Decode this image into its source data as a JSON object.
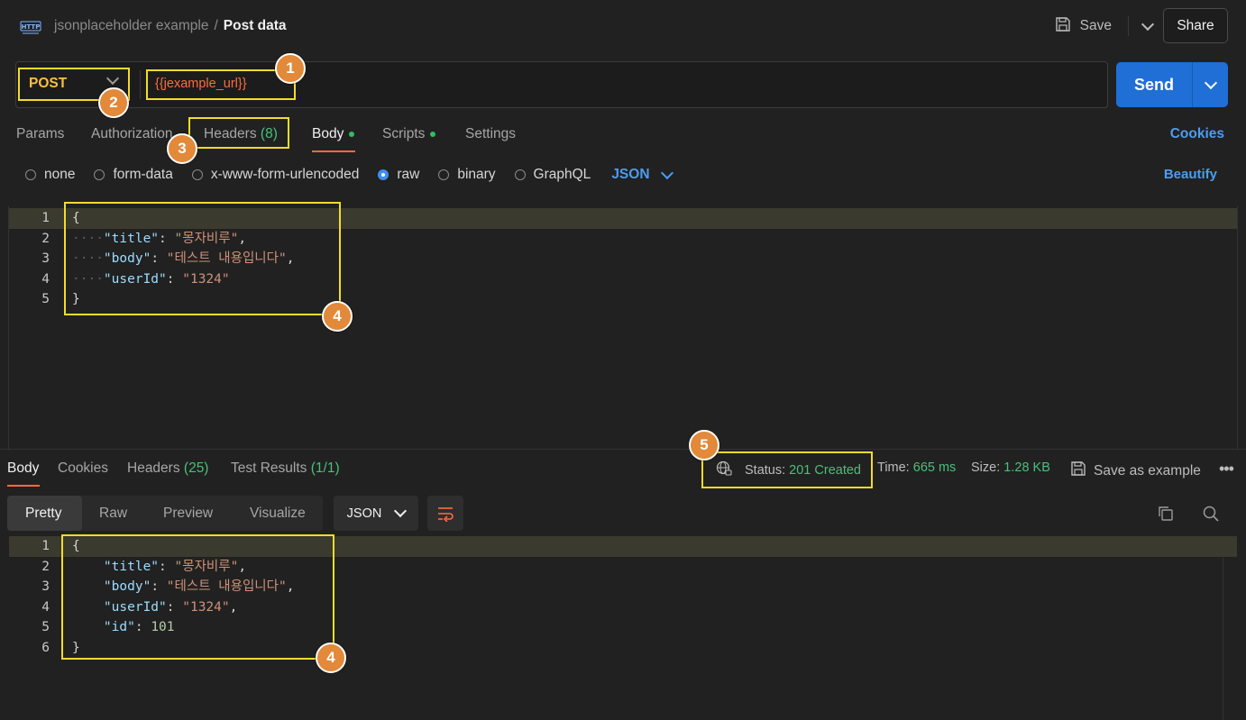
{
  "topbar": {
    "collection": "jsonplaceholder example",
    "separator": "/",
    "request_name": "Post data",
    "save_label": "Save",
    "share_label": "Share",
    "logo_text": "HTTP"
  },
  "request": {
    "method": "POST",
    "url": "{{jexample_url}}",
    "send_label": "Send"
  },
  "request_tabs": {
    "params": "Params",
    "authorization": "Authorization",
    "headers": "Headers",
    "headers_count": "(8)",
    "body": "Body",
    "scripts": "Scripts",
    "settings": "Settings",
    "cookies": "Cookies"
  },
  "body_types": {
    "none": "none",
    "form_data": "form-data",
    "urlencoded": "x-www-form-urlencoded",
    "raw": "raw",
    "binary": "binary",
    "graphql": "GraphQL",
    "format": "JSON",
    "beautify": "Beautify"
  },
  "request_body": {
    "line_numbers": [
      "1",
      "2",
      "3",
      "4",
      "5"
    ],
    "open": "{",
    "close": "}",
    "title_key": "\"title\"",
    "title_val": "\"몽자비루\"",
    "body_key": "\"body\"",
    "body_val": "\"테스트 내용입니다\"",
    "userid_key": "\"userId\"",
    "userid_val": "\"1324\""
  },
  "response_tabs": {
    "body": "Body",
    "cookies": "Cookies",
    "headers": "Headers",
    "headers_count": "(25)",
    "tests": "Test Results",
    "tests_count": "(1/1)"
  },
  "response_meta": {
    "status_label": "Status:",
    "status_value": "201 Created",
    "time_label": "Time:",
    "time_value": "665 ms",
    "size_label": "Size:",
    "size_value": "1.28 KB",
    "save_example": "Save as example"
  },
  "view_tabs": {
    "pretty": "Pretty",
    "raw": "Raw",
    "preview": "Preview",
    "visualize": "Visualize",
    "format": "JSON"
  },
  "response_body": {
    "line_numbers": [
      "1",
      "2",
      "3",
      "4",
      "5",
      "6"
    ],
    "open": "{",
    "close": "}",
    "title_key": "\"title\"",
    "title_val": "\"몽자비루\"",
    "body_key": "\"body\"",
    "body_val": "\"테스트 내용입니다\"",
    "userid_key": "\"userId\"",
    "userid_val": "\"1324\"",
    "id_key": "\"id\"",
    "id_val": "101"
  },
  "annotations": [
    "1",
    "2",
    "3",
    "4",
    "4",
    "5"
  ],
  "colors": {
    "accent_blue": "#1f6fd6",
    "method_yellow": "#f5c242",
    "url_orange": "#ff6b3d",
    "success_green": "#49c07a",
    "annotation_box": "#f2dc2a",
    "annotation_badge": "#e2893a"
  }
}
